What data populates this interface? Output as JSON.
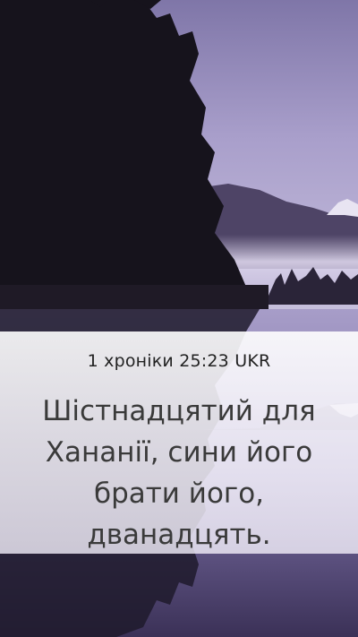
{
  "verse": {
    "reference": "1 хроніки 25:23 UKR",
    "text": "Шістнадцятий для Хананії, сини його брати його, дванадцять."
  },
  "colors": {
    "sky_top": "#8e84b8",
    "sky_mid": "#b7acd4",
    "forest": "#1a1620",
    "mist": "#d8d2e8",
    "water": "#6b5f95"
  },
  "background": {
    "scene": "lake-mountain-dusk"
  }
}
